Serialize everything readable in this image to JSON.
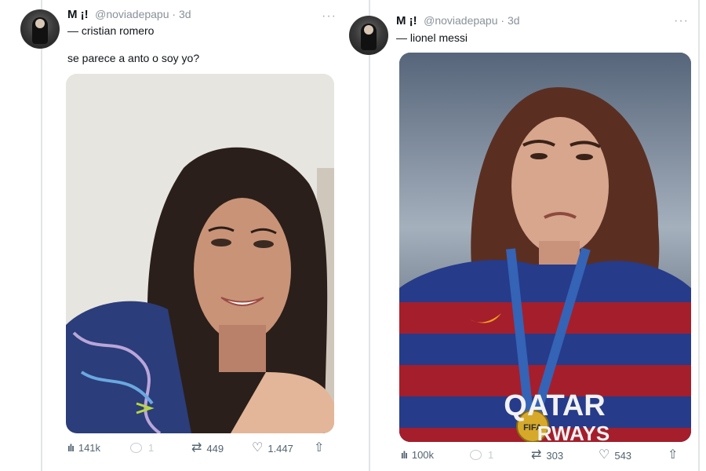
{
  "tweets": [
    {
      "author_name": "M ¡!",
      "handle": "@noviadepapu · 3d",
      "subtitle": "— cristian romero",
      "text": "se parece a anto o soy yo?",
      "views": "141k",
      "replies": "1",
      "retweets": "449",
      "likes": "1.447"
    },
    {
      "author_name": "M ¡!",
      "handle": "@noviadepapu · 3d",
      "subtitle": "— lionel messi",
      "text": "",
      "views": "100k",
      "replies": "1",
      "retweets": "303",
      "likes": "543"
    }
  ],
  "icons": {
    "views": "bar-chart-icon",
    "reply": "speech-bubble-icon",
    "retweet": "retweet-icon",
    "like": "heart-icon",
    "share": "share-icon",
    "more": "ellipsis-icon"
  },
  "photo_text": {
    "sponsor": "QATAR",
    "sponsor_line2": "RWAYS",
    "medal": "FIFA"
  }
}
